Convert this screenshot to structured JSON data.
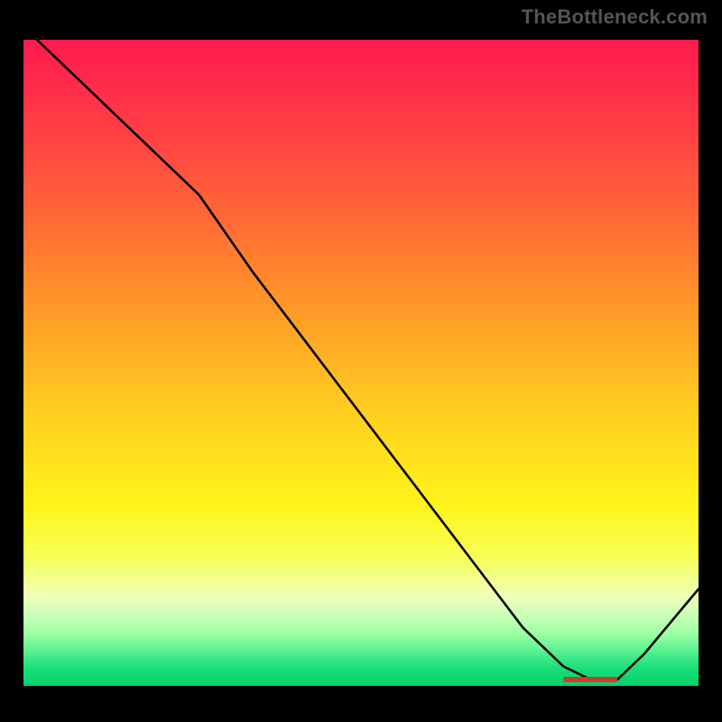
{
  "watermark": "TheBottleneck.com",
  "marker_label": "",
  "chart_data": {
    "type": "line",
    "title": "",
    "xlabel": "",
    "ylabel": "",
    "x_range": [
      0,
      100
    ],
    "y_range": [
      0,
      100
    ],
    "grid": false,
    "legend": false,
    "comment": "x is horizontal position (%), y is vertical 0=bottom 100=top. Values estimated from pixel positions of the black curve.",
    "series": [
      {
        "name": "curve",
        "x": [
          2,
          10,
          18,
          26,
          34,
          42,
          50,
          58,
          66,
          74,
          80,
          84,
          88,
          92,
          96,
          100
        ],
        "y": [
          100,
          92,
          84,
          76,
          64,
          53,
          42,
          31,
          20,
          9,
          3,
          1,
          1,
          5,
          10,
          15
        ]
      }
    ],
    "annotations": [
      {
        "type": "minimum-marker",
        "x": 84,
        "y": 1
      }
    ],
    "gradient_stops_pct_from_top": {
      "0": "#ff1a4f",
      "10": "#ff3348",
      "28": "#ff6a35",
      "42": "#ff9a28",
      "58": "#ffcf1f",
      "72": "#fff41a",
      "80": "#f7ff55",
      "86": "#efffb7",
      "89": "#c9ffb8",
      "92": "#9affa3",
      "95": "#4eef8c",
      "97": "#1fe07b",
      "100": "#00d16b"
    }
  }
}
